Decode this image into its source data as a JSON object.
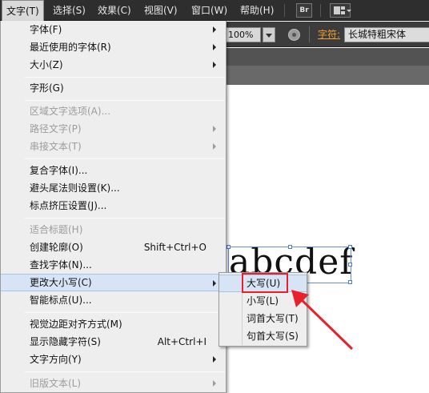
{
  "menubar": {
    "items": [
      {
        "label": "文字(T)",
        "active": true
      },
      {
        "label": "选择(S)"
      },
      {
        "label": "效果(C)"
      },
      {
        "label": "视图(V)"
      },
      {
        "label": "窗口(W)"
      },
      {
        "label": "帮助(H)"
      }
    ],
    "bridge_label": "Br"
  },
  "controlbar": {
    "opacity_value": "100%",
    "character_label": "字符:",
    "font_name": "长城特粗宋体"
  },
  "canvas": {
    "text": "abcdef"
  },
  "type_menu": {
    "items": [
      {
        "label": "字体(F)",
        "submenu": true
      },
      {
        "label": "最近使用的字体(R)",
        "submenu": true
      },
      {
        "label": "大小(Z)",
        "submenu": true
      },
      {
        "label": "字形(G)"
      },
      {
        "label": "区域文字选项(A)...",
        "disabled": true
      },
      {
        "label": "路径文字(P)",
        "disabled": true,
        "submenu": true
      },
      {
        "label": "串接文本(T)",
        "disabled": true,
        "submenu": true
      },
      {
        "label": "复合字体(I)..."
      },
      {
        "label": "避头尾法则设置(K)..."
      },
      {
        "label": "标点挤压设置(J)..."
      },
      {
        "label": "适合标题(H)",
        "disabled": true
      },
      {
        "label": "创建轮廓(O)",
        "shortcut": "Shift+Ctrl+O"
      },
      {
        "label": "查找字体(N)..."
      },
      {
        "label": "更改大小写(C)",
        "submenu": true,
        "highlighted": true
      },
      {
        "label": "智能标点(U)..."
      },
      {
        "label": "视觉边距对齐方式(M)"
      },
      {
        "label": "显示隐藏字符(S)",
        "shortcut": "Alt+Ctrl+I"
      },
      {
        "label": "文字方向(Y)",
        "submenu": true
      },
      {
        "label": "旧版文本(L)",
        "disabled": true,
        "submenu": true
      }
    ]
  },
  "change_case_submenu": {
    "items": [
      {
        "label": "大写(U)",
        "highlighted": true
      },
      {
        "label": "小写(L)"
      },
      {
        "label": "词首大写(T)"
      },
      {
        "label": "句首大写(S)"
      }
    ]
  },
  "colors": {
    "menubar_bg": "#2e2e2e",
    "menu_bg": "#eeeeee",
    "menu_hover": "#d6e4f5",
    "disabled_text": "#9c9c9c",
    "accent_label": "#f0a030",
    "annotation_red": "#e8202a",
    "selection_blue": "#4a7bd9"
  }
}
